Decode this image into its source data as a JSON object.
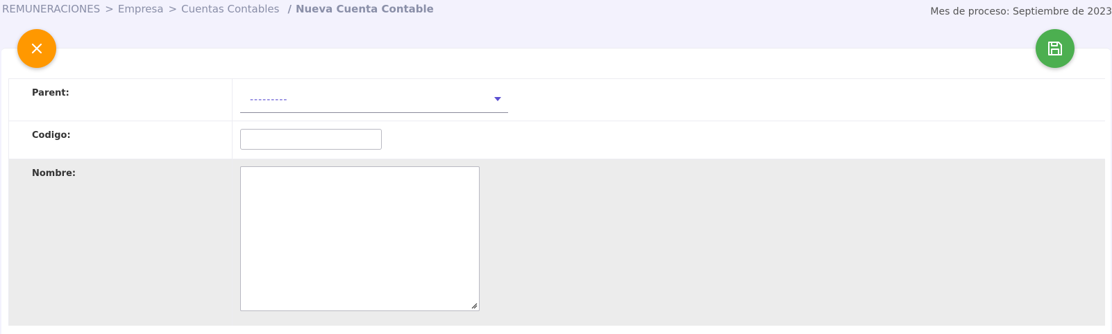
{
  "breadcrumb": {
    "items": [
      "REMUNERACIONES",
      "Empresa",
      "Cuentas Contables"
    ],
    "separator": ">",
    "current_separator": "/",
    "current": "Nueva Cuenta Contable"
  },
  "header": {
    "process_month": "Mes de proceso: Septiembre de 2023"
  },
  "actions": {
    "close_icon": "close-icon",
    "save_icon": "floppy-disk-icon",
    "close_color": "#ff9800",
    "save_color": "#4caf50"
  },
  "form": {
    "parent_label": "Parent:",
    "parent_value": "---------",
    "codigo_label": "Codigo:",
    "codigo_value": "",
    "nombre_label": "Nombre:",
    "nombre_value": ""
  },
  "colors": {
    "accent": "#5b4fd1",
    "background": "#f3f2fd"
  }
}
